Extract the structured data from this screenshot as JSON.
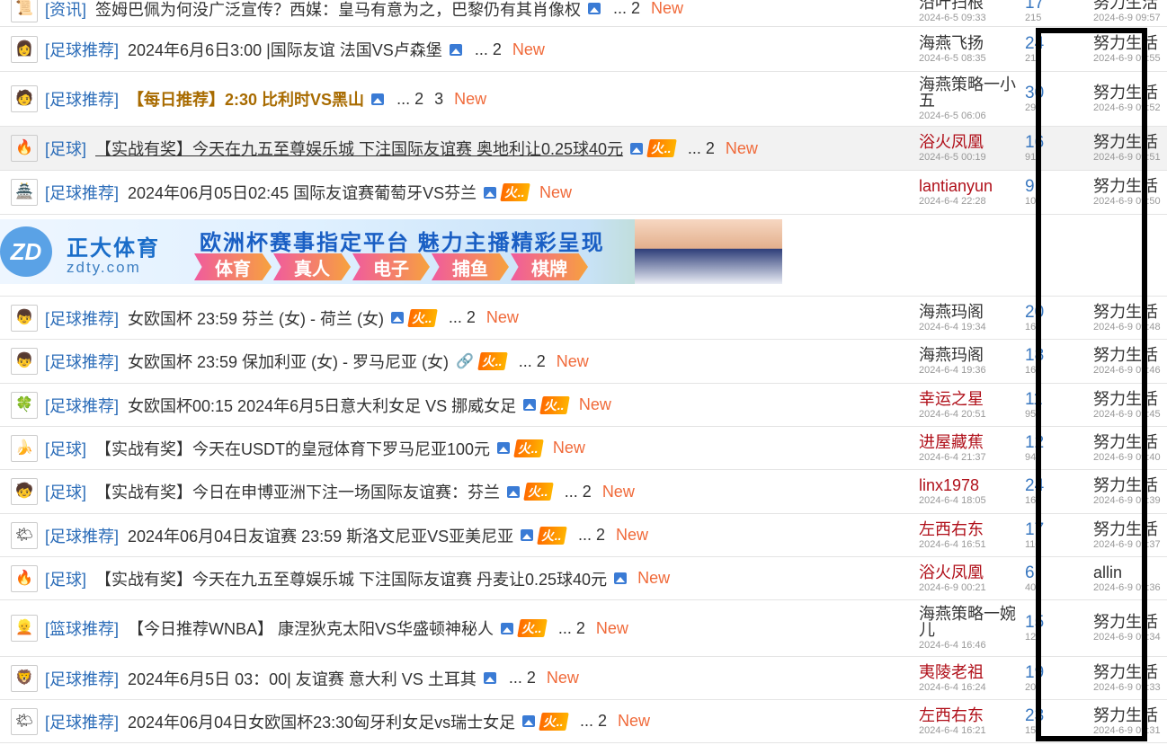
{
  "threads": [
    {
      "avatar": "📜",
      "category": "[资讯]",
      "title": "签姆巴佩为何没广泛宣传？西媒：皇马有意为之，巴黎仍有其肖像权",
      "title_style": "",
      "icons": [
        "image"
      ],
      "hot": false,
      "pages": [
        "... 2"
      ],
      "new_label": "New",
      "author": "沿叶扫根",
      "author_red": false,
      "post_date": "2024-6-5 09:33",
      "replies": "17",
      "views": "215",
      "last_user": "努力生活",
      "last_time": "2024-6-9 09:57",
      "highlight": false
    },
    {
      "avatar": "👩",
      "category": "[足球推荐]",
      "title": "2024年6月6日3:00 |国际友谊 法国VS卢森堡",
      "title_style": "",
      "icons": [
        "image"
      ],
      "hot": false,
      "pages": [
        "... 2"
      ],
      "new_label": "New",
      "author": "海燕飞扬",
      "author_red": false,
      "post_date": "2024-6-5 08:35",
      "replies": "24",
      "views": "213",
      "last_user": "努力生活",
      "last_time": "2024-6-9 09:55",
      "highlight": false
    },
    {
      "avatar": "🧑",
      "category": "[足球推荐]",
      "title": "【每日推荐】2:30 比利时VS黑山",
      "title_style": "brown",
      "icons": [
        "image"
      ],
      "hot": false,
      "pages": [
        "... 2",
        "3"
      ],
      "new_label": "New",
      "author": "海燕策略一小五",
      "author_red": false,
      "post_date": "2024-6-5 06:06",
      "replies": "30",
      "views": "292",
      "last_user": "努力生活",
      "last_time": "2024-6-9 09:52",
      "highlight": false
    },
    {
      "avatar": "🔥",
      "category": "[足球]",
      "title": "【实战有奖】今天在九五至尊娱乐城 下注国际友谊赛 奥地利让0.25球40元",
      "title_style": "ul",
      "icons": [
        "image"
      ],
      "hot": true,
      "pages": [
        "... 2"
      ],
      "new_label": "New",
      "author": "浴火凤凰",
      "author_red": true,
      "post_date": "2024-6-5 00:19",
      "replies": "16",
      "views": "91",
      "last_user": "努力生活",
      "last_time": "2024-6-9 09:51",
      "highlight": true
    },
    {
      "avatar": "🏯",
      "category": "[足球推荐]",
      "title": "2024年06月05日02:45 国际友谊赛葡萄牙VS芬兰",
      "title_style": "",
      "icons": [
        "image"
      ],
      "hot": true,
      "pages": [],
      "new_label": "New",
      "author": "lantianyun",
      "author_red": true,
      "post_date": "2024-6-4 22:28",
      "replies": "9",
      "views": "105",
      "last_user": "努力生活",
      "last_time": "2024-6-9 09:50",
      "highlight": false
    },
    {
      "avatar": "👦",
      "category": "[足球推荐]",
      "title": "女欧国杯 23:59 芬兰 (女) - 荷兰 (女)",
      "title_style": "",
      "icons": [
        "image"
      ],
      "hot": true,
      "pages": [
        "... 2"
      ],
      "new_label": "New",
      "author": "海燕玛阁",
      "author_red": false,
      "post_date": "2024-6-4 19:34",
      "replies": "20",
      "views": "167",
      "last_user": "努力生活",
      "last_time": "2024-6-9 09:48",
      "highlight": false
    },
    {
      "avatar": "👦",
      "category": "[足球推荐]",
      "title": "女欧国杯 23:59 保加利亚 (女) - 罗马尼亚 (女)",
      "title_style": "",
      "icons": [
        "attach"
      ],
      "hot": true,
      "pages": [
        "... 2"
      ],
      "new_label": "New",
      "author": "海燕玛阁",
      "author_red": false,
      "post_date": "2024-6-4 19:36",
      "replies": "18",
      "views": "165",
      "last_user": "努力生活",
      "last_time": "2024-6-9 09:46",
      "highlight": false
    },
    {
      "avatar": "🍀",
      "category": "[足球推荐]",
      "title": "女欧国杯00:15 2024年6月5日意大利女足 VS 挪威女足",
      "title_style": "",
      "icons": [
        "image"
      ],
      "hot": true,
      "pages": [],
      "new_label": "New",
      "author": "幸运之星",
      "author_red": true,
      "post_date": "2024-6-4 20:51",
      "replies": "11",
      "views": "95",
      "last_user": "努力生活",
      "last_time": "2024-6-9 09:45",
      "highlight": false
    },
    {
      "avatar": "🍌",
      "category": "[足球]",
      "title": "【实战有奖】今天在USDT的皇冠体育下罗马尼亚100元",
      "title_style": "",
      "icons": [
        "image"
      ],
      "hot": true,
      "pages": [],
      "new_label": "New",
      "author": "进屋藏蕉",
      "author_red": true,
      "post_date": "2024-6-4 21:37",
      "replies": "12",
      "views": "94",
      "last_user": "努力生活",
      "last_time": "2024-6-9 09:40",
      "highlight": false
    },
    {
      "avatar": "🧒",
      "category": "[足球]",
      "title": "【实战有奖】今日在申博亚洲下注一场国际友谊赛：芬兰",
      "title_style": "",
      "icons": [
        "image"
      ],
      "hot": true,
      "pages": [
        "... 2"
      ],
      "new_label": "New",
      "author": "linx1978",
      "author_red": true,
      "post_date": "2024-6-4 18:05",
      "replies": "24",
      "views": "166",
      "last_user": "努力生活",
      "last_time": "2024-6-9 09:39",
      "highlight": false
    },
    {
      "avatar": "🌤",
      "category": "[足球推荐]",
      "title": "2024年06月04日友谊赛 23:59 斯洛文尼亚VS亚美尼亚",
      "title_style": "",
      "icons": [
        "image"
      ],
      "hot": true,
      "pages": [
        "... 2"
      ],
      "new_label": "New",
      "author": "左西右东",
      "author_red": true,
      "post_date": "2024-6-4 16:51",
      "replies": "17",
      "views": "110",
      "last_user": "努力生活",
      "last_time": "2024-6-9 09:37",
      "highlight": false
    },
    {
      "avatar": "🔥",
      "category": "[足球]",
      "title": "【实战有奖】今天在九五至尊娱乐城 下注国际友谊赛 丹麦让0.25球40元",
      "title_style": "",
      "icons": [
        "image"
      ],
      "hot": false,
      "pages": [],
      "new_label": "New",
      "author": "浴火凤凰",
      "author_red": true,
      "post_date": "2024-6-9 00:21",
      "replies": "6",
      "views": "40",
      "last_user": "allin",
      "last_time": "2024-6-9 09:36",
      "highlight": false
    },
    {
      "avatar": "👱",
      "category": "[篮球推荐]",
      "title": "【今日推荐WNBA】 康涅狄克太阳VS华盛顿神秘人",
      "title_style": "",
      "icons": [
        "image"
      ],
      "hot": true,
      "pages": [
        "... 2"
      ],
      "new_label": "New",
      "author": "海燕策略一婉儿",
      "author_red": false,
      "post_date": "2024-6-4 16:46",
      "replies": "15",
      "views": "122",
      "last_user": "努力生活",
      "last_time": "2024-6-9 09:34",
      "highlight": false
    },
    {
      "avatar": "🦁",
      "category": "[足球推荐]",
      "title": "2024年6月5日 03：00| 友谊赛 意大利 VS 土耳其",
      "title_style": "",
      "icons": [
        "image"
      ],
      "hot": false,
      "pages": [
        "... 2"
      ],
      "new_label": "New",
      "author": "夷陵老祖",
      "author_red": true,
      "post_date": "2024-6-4 16:24",
      "replies": "19",
      "views": "200",
      "last_user": "努力生活",
      "last_time": "2024-6-9 09:33",
      "highlight": false
    },
    {
      "avatar": "🌤",
      "category": "[足球推荐]",
      "title": "2024年06月04日女欧国杯23:30匈牙利女足vs瑞士女足",
      "title_style": "",
      "icons": [
        "image"
      ],
      "hot": true,
      "pages": [
        "... 2"
      ],
      "new_label": "New",
      "author": "左西右东",
      "author_red": true,
      "post_date": "2024-6-4 16:21",
      "replies": "23",
      "views": "157",
      "last_user": "努力生活",
      "last_time": "2024-6-9 09:31",
      "highlight": false
    }
  ],
  "hot_label": "火..",
  "ad": {
    "logo_text": "ZD",
    "brand": "正大体育",
    "site": "zdty.com",
    "slogan": "欧洲杯赛事指定平台  魅力主播精彩呈现",
    "chips": [
      "体育",
      "真人",
      "电子",
      "捕鱼",
      "棋牌"
    ]
  }
}
